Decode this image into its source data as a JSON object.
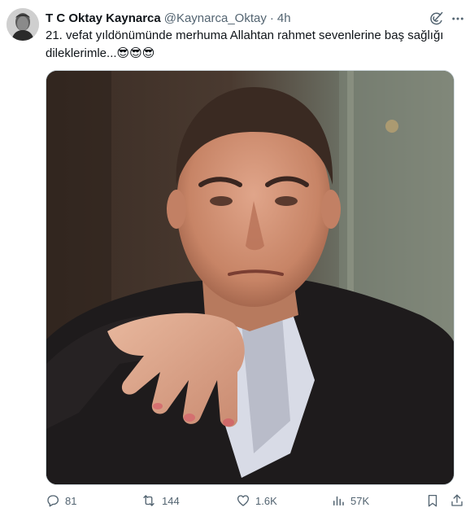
{
  "author": {
    "display_name": "T C Oktay Kaynarca",
    "handle": "@Kaynarca_Oktay",
    "separator": "·",
    "time": "4h"
  },
  "tweet": {
    "text": "21. vefat yıldönümünde  merhuma Allahtan rahmet sevenlerine baş sağlığı dileklerimle...",
    "emojis": "😎😎😎"
  },
  "actions": {
    "replies": "81",
    "reposts": "144",
    "likes": "1.6K",
    "views": "57K"
  },
  "icons": {
    "avatar": "profile-photo",
    "grok": "grok-icon",
    "more": "more-dots-icon",
    "reply": "reply-icon",
    "repost": "repost-icon",
    "like": "heart-icon",
    "views": "views-bar-chart-icon",
    "bookmark": "bookmark-icon",
    "share": "share-icon"
  },
  "colors": {
    "text_primary": "#0f1419",
    "text_secondary": "#536471",
    "border": "#cfd9de"
  }
}
